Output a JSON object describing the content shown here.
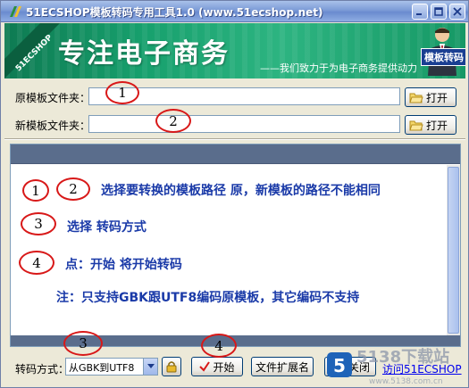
{
  "window": {
    "title": "51ECSHOP模板转码专用工具1.0 (www.51ecshop.net)"
  },
  "banner": {
    "corner_label": "51ECSHOP",
    "slogan": "专注电子商务",
    "tagline": "——我们致力于为电子商务提供动力",
    "badge": "模板转码"
  },
  "form": {
    "source_label": "原模板文件夹：",
    "source_value": "",
    "target_label": "新模板文件夹：",
    "target_value": "",
    "open_label": "打开"
  },
  "annotations": {
    "n1": "1",
    "n2": "2",
    "n3": "3",
    "n4": "4",
    "color": "#d81818"
  },
  "instructions": {
    "step12": "选择要转换的模板路径 原，新模板的路径不能相同",
    "step3": "选择 转码方式",
    "step4": "点：开始 将开始转码",
    "note": "注：只支持GBK跟UTF8编码原模板，其它编码不支持",
    "text_color": "#1a3aa8"
  },
  "toolbar": {
    "encoding_label": "转码方式：",
    "encoding_value": "从GBK到UTF8",
    "start_label": "开始",
    "ext_label": "文件扩展名",
    "close_label": "关闭",
    "link_label": "访问51ECSHOP"
  },
  "watermark": {
    "text": "5138下载站",
    "url": "www.5138.com.cn"
  },
  "colors": {
    "titlebar": "#7c9bd6",
    "banner_green": "#17a06d",
    "panel_header": "#5a6d8c"
  }
}
